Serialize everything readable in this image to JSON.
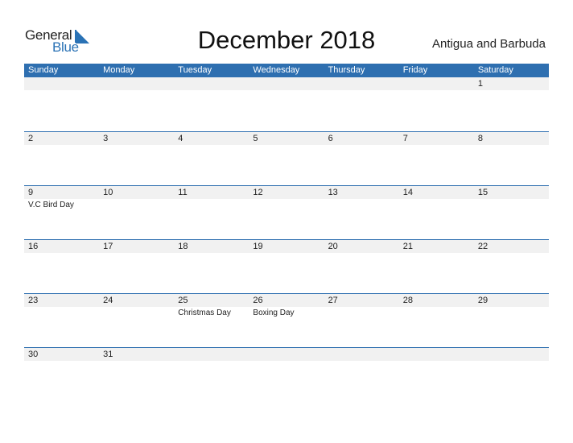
{
  "logo": {
    "word1": "General",
    "word2": "Blue"
  },
  "title": "December 2018",
  "country": "Antigua and Barbuda",
  "weekdays": [
    "Sunday",
    "Monday",
    "Tuesday",
    "Wednesday",
    "Thursday",
    "Friday",
    "Saturday"
  ],
  "weeks": [
    {
      "days": [
        "",
        "",
        "",
        "",
        "",
        "",
        "1"
      ],
      "events": [
        "",
        "",
        "",
        "",
        "",
        "",
        ""
      ]
    },
    {
      "days": [
        "2",
        "3",
        "4",
        "5",
        "6",
        "7",
        "8"
      ],
      "events": [
        "",
        "",
        "",
        "",
        "",
        "",
        ""
      ]
    },
    {
      "days": [
        "9",
        "10",
        "11",
        "12",
        "13",
        "14",
        "15"
      ],
      "events": [
        "V.C Bird Day",
        "",
        "",
        "",
        "",
        "",
        ""
      ]
    },
    {
      "days": [
        "16",
        "17",
        "18",
        "19",
        "20",
        "21",
        "22"
      ],
      "events": [
        "",
        "",
        "",
        "",
        "",
        "",
        ""
      ]
    },
    {
      "days": [
        "23",
        "24",
        "25",
        "26",
        "27",
        "28",
        "29"
      ],
      "events": [
        "",
        "",
        "Christmas Day",
        "Boxing Day",
        "",
        "",
        ""
      ]
    },
    {
      "days": [
        "30",
        "31",
        "",
        "",
        "",
        "",
        ""
      ],
      "events": [
        "",
        "",
        "",
        "",
        "",
        "",
        ""
      ]
    }
  ],
  "colors": {
    "accent": "#2e6fb0",
    "strip": "#f1f1f1"
  }
}
